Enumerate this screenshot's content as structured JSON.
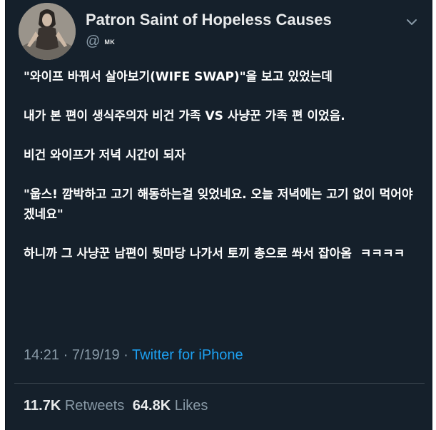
{
  "tweet": {
    "author_name": "Patron Saint of Hopeless Causes",
    "handle_prefix": "@",
    "handle": "MK",
    "paragraphs": [
      "\"와이프 바꿔서 살아보기(WIFE SWAP)\"을 보고 있었는데",
      "내가 본 편이 생식주의자 비건 가족 VS 사냥꾼 가족 편 이었음.",
      "비건 와이프가 저녁 시간이 되자",
      "\"웁스! 깜박하고 고기 해동하는걸 잊었네요. 오늘 저녁에는 고기 없이 먹어야겠네요\"",
      "하니까 그 사냥꾼 남편이 뒷마당 나가서 토끼 총으로 쏴서 잡아옴  ㅋㅋㅋㅋ"
    ],
    "time": "14:21",
    "date": "7/19/19",
    "separator": "·",
    "source": "Twitter for iPhone",
    "retweets_count": "11.7K",
    "retweets_label": "Retweets",
    "likes_count": "64.8K",
    "likes_label": "Likes"
  },
  "icons": {
    "menu": "chevron-down-icon",
    "avatar": "profile-avatar"
  },
  "colors": {
    "background": "#15202b",
    "text": "#e7e9ea",
    "muted": "#8899a6",
    "link": "#1da1f2",
    "divider": "#38444d"
  }
}
